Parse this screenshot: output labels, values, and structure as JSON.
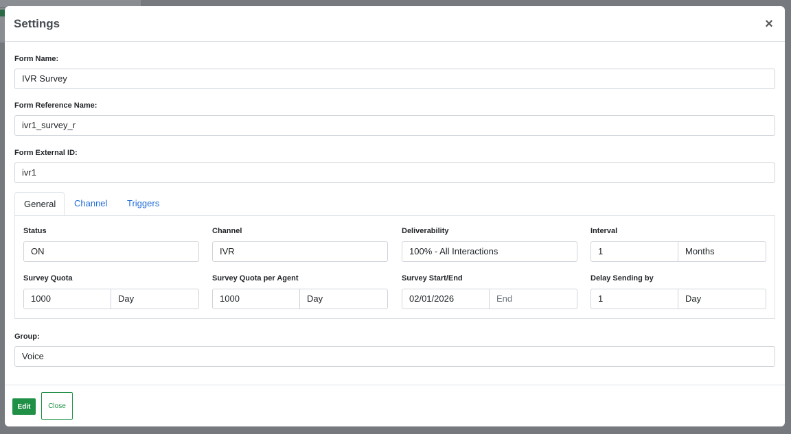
{
  "modal": {
    "title": "Settings",
    "close_glyph": "×"
  },
  "form": {
    "name_label": "Form Name:",
    "name_value": "IVR Survey",
    "ref_label": "Form Reference Name:",
    "ref_value": "ivr1_survey_r",
    "ext_label": "Form External ID:",
    "ext_value": "ivr1",
    "group_label": "Group:",
    "group_value": "Voice"
  },
  "tabs": [
    {
      "label": "General",
      "active": true
    },
    {
      "label": "Channel",
      "active": false
    },
    {
      "label": "Triggers",
      "active": false
    }
  ],
  "general": {
    "status_label": "Status",
    "status_value": "ON",
    "channel_label": "Channel",
    "channel_value": "IVR",
    "deliverability_label": "Deliverability",
    "deliverability_value": "100% - All Interactions",
    "interval_label": "Interval",
    "interval_value": "1",
    "interval_unit": "Months",
    "quota_label": "Survey Quota",
    "quota_value": "1000",
    "quota_unit": "Day",
    "agent_quota_label": "Survey Quota per Agent",
    "agent_quota_value": "1000",
    "agent_quota_unit": "Day",
    "start_end_label": "Survey Start/End",
    "start_value": "02/01/2026",
    "end_placeholder": "End",
    "delay_label": "Delay Sending by",
    "delay_value": "1",
    "delay_unit": "Day"
  },
  "footer": {
    "edit_label": "Edit",
    "close_label": "Close"
  },
  "colors": {
    "primary_green": "#1f9046",
    "link_blue": "#1e6bd6",
    "backdrop": "#767a7f"
  },
  "icons": {
    "close": "close-icon"
  }
}
